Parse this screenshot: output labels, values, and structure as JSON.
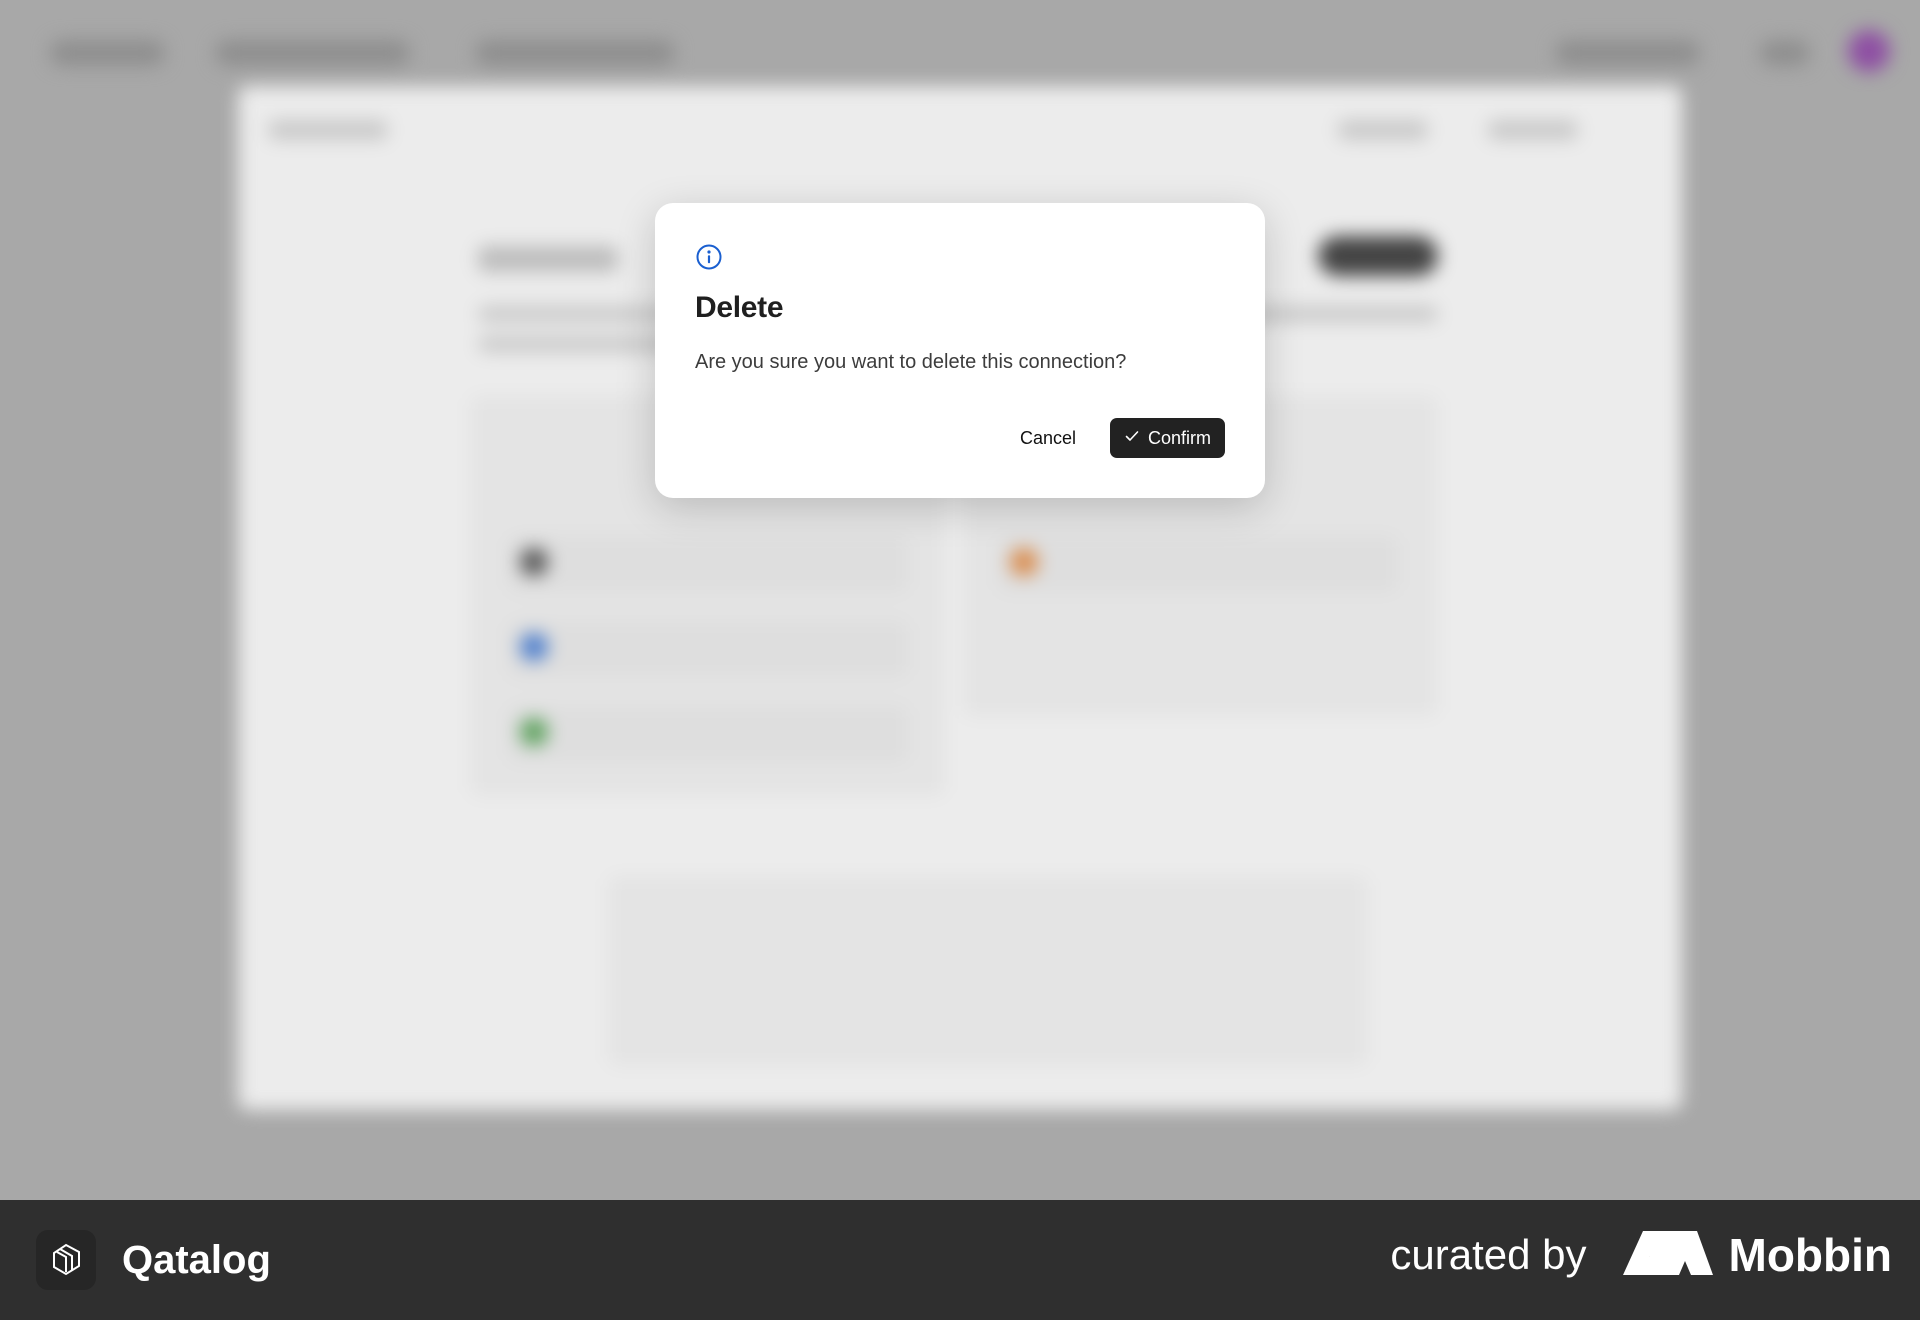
{
  "modal": {
    "title": "Delete",
    "message": "Are you sure you want to delete this connection?",
    "cancel_label": "Cancel",
    "confirm_label": "Confirm",
    "icon": "info-circle-icon",
    "icon_color": "#1a5fd0"
  },
  "footer": {
    "app_name": "Qatalog",
    "curated_label": "curated by",
    "curator_name": "Mobbin"
  }
}
